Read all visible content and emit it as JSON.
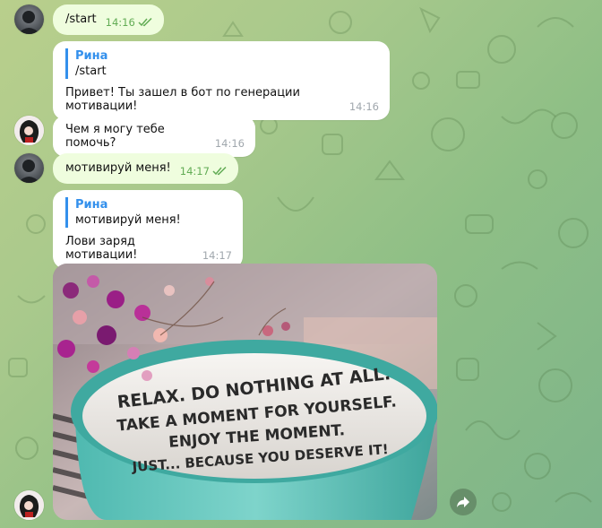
{
  "messages": {
    "m1": {
      "text": "/start",
      "time": "14:16"
    },
    "m2": {
      "reply_name": "Рина",
      "reply_text": "/start",
      "text": "Привет! Ты зашел в бот по генерации мотивации!",
      "time": "14:16"
    },
    "m3": {
      "text": "Чем я могу тебе помочь?",
      "time": "14:16"
    },
    "m4": {
      "text": "мотивируй меня!",
      "time": "14:17"
    },
    "m5": {
      "reply_name": "Рина",
      "reply_text": "мотивируй меня!",
      "text": "Лови заряд мотивации!",
      "time": "14:17"
    }
  },
  "photo": {
    "lines": [
      "RELAX. DO NOTHING AT ALL.",
      "TAKE A MOMENT FOR YOURSELF.",
      "ENJOY THE MOMENT.",
      "JUST... BECAUSE YOU DESERVE IT!"
    ]
  },
  "icons": {
    "share": "share-icon",
    "read": "double-check-icon"
  },
  "colors": {
    "out_bubble": "#effdde",
    "in_bubble": "#ffffff",
    "accent": "#3390ec",
    "time_out": "#62ac55"
  }
}
